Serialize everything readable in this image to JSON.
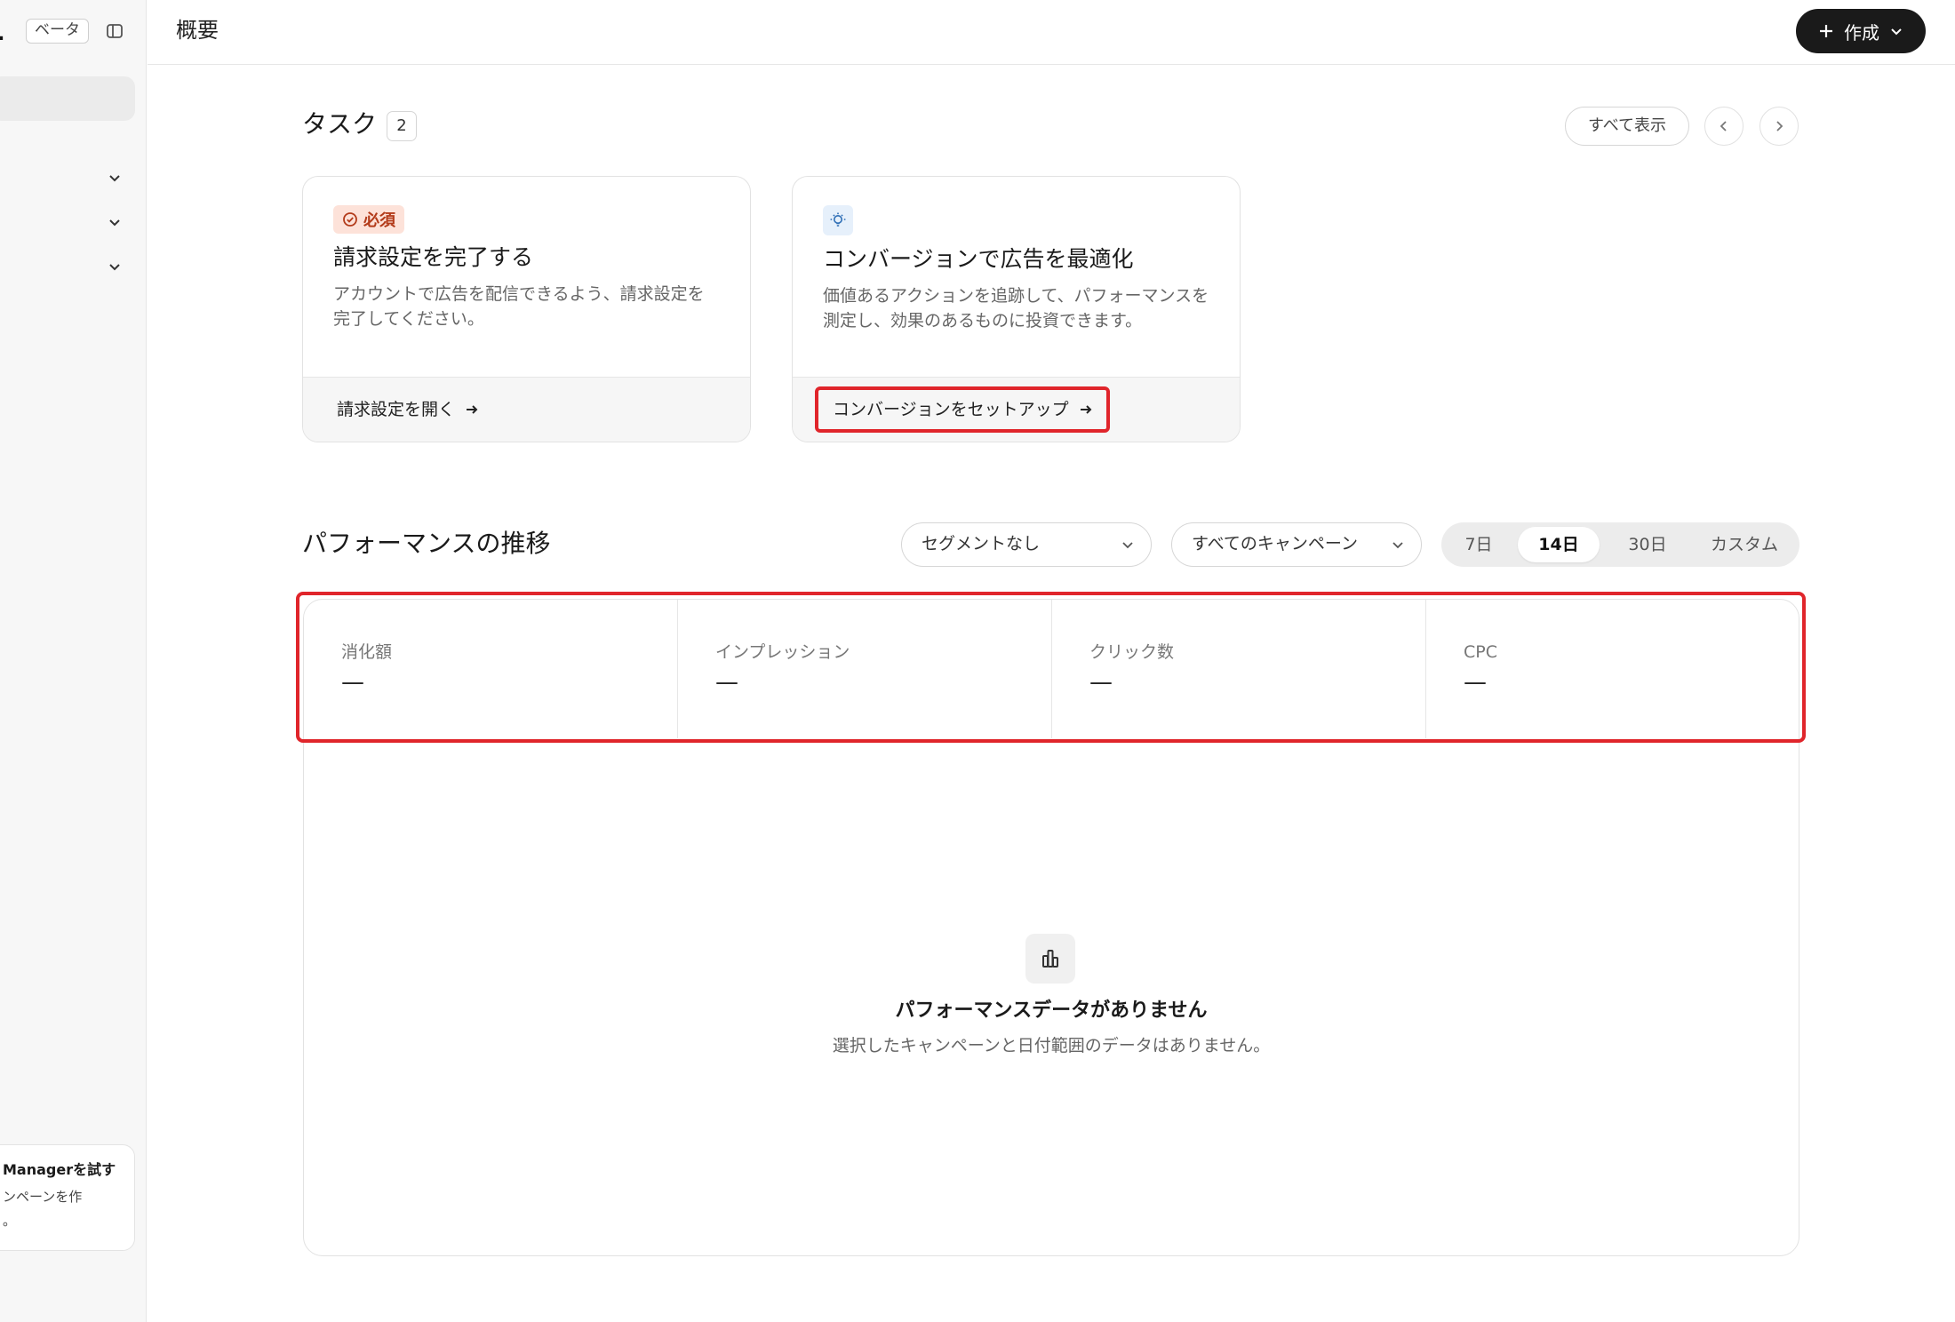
{
  "sidebar": {
    "beta_label": "ベータ",
    "promo": {
      "title": "Managerを試す",
      "body_line1": "ンペーンを作",
      "body_line2": "。"
    }
  },
  "header": {
    "title": "概要",
    "create_label": "作成"
  },
  "tasks": {
    "title": "タスク",
    "count": "2",
    "show_all_label": "すべて表示",
    "cards": [
      {
        "badge": "必須",
        "title": "請求設定を完了する",
        "description": "アカウントで広告を配信できるよう、請求設定を完了してください。",
        "link": "請求設定を開く"
      },
      {
        "title": "コンバージョンで広告を最適化",
        "description": "価値あるアクションを追跡して、パフォーマンスを測定し、効果のあるものに投資できます。",
        "link": "コンバージョンをセットアップ"
      }
    ]
  },
  "performance": {
    "title": "パフォーマンスの推移",
    "segment_dropdown": "セグメントなし",
    "campaign_dropdown": "すべてのキャンペーン",
    "ranges": [
      "7日",
      "14日",
      "30日",
      "カスタム"
    ],
    "selected_range": "14日",
    "metrics": [
      {
        "label": "消化額",
        "value": "—"
      },
      {
        "label": "インプレッション",
        "value": "—"
      },
      {
        "label": "クリック数",
        "value": "—"
      },
      {
        "label": "CPC",
        "value": "—"
      }
    ],
    "empty_title": "パフォーマンスデータがありません",
    "empty_subtitle": "選択したキャンペーンと日付範囲のデータはありません。"
  }
}
